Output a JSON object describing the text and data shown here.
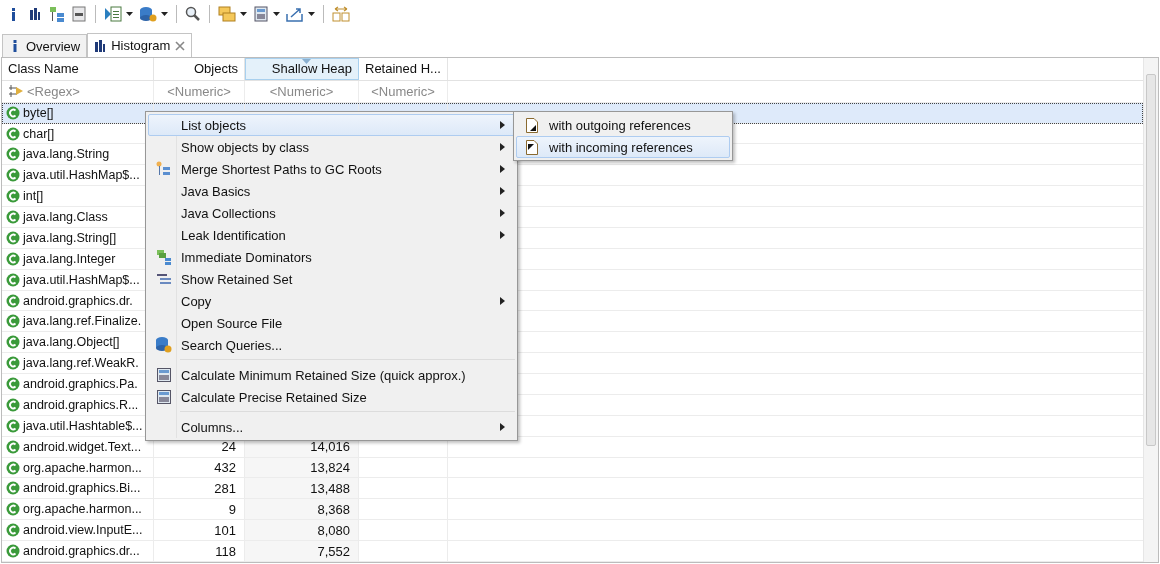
{
  "toolbar": [
    {
      "dropdown": false
    },
    {
      "dropdown": false
    },
    {
      "dropdown": false
    },
    {
      "dropdown": false
    },
    {
      "dropdown": true
    },
    {
      "dropdown": true
    },
    {
      "dropdown": false
    },
    {
      "dropdown": true
    },
    {
      "dropdown": true
    },
    {
      "dropdown": true
    },
    {
      "dropdown": false
    }
  ],
  "tabs": [
    {
      "label": "Overview",
      "selected": false,
      "closable": false
    },
    {
      "label": "Histogram",
      "selected": true,
      "closable": true
    }
  ],
  "table": {
    "columns": [
      {
        "label": "Class Name",
        "sorted": false,
        "filter": "<Regex>"
      },
      {
        "label": "Objects",
        "sorted": false,
        "filter": "<Numeric>"
      },
      {
        "label": "Shallow Heap",
        "sorted": true,
        "filter": "<Numeric>"
      },
      {
        "label": "Retained H...",
        "sorted": false,
        "filter": "<Numeric>"
      }
    ],
    "rows": [
      {
        "name": "byte[]",
        "selected": true
      },
      {
        "name": "char[]",
        "selected": false
      },
      {
        "name": "java.lang.String",
        "selected": false
      },
      {
        "name": "java.util.HashMap$...",
        "selected": false
      },
      {
        "name": "int[]",
        "selected": false
      },
      {
        "name": "java.lang.Class",
        "selected": false
      },
      {
        "name": "java.lang.String[]",
        "selected": false
      },
      {
        "name": "java.lang.Integer",
        "selected": false
      },
      {
        "name": "java.util.HashMap$...",
        "selected": false
      },
      {
        "name": "android.graphics.dr.",
        "selected": false
      },
      {
        "name": "java.lang.ref.Finalize.",
        "selected": false
      },
      {
        "name": "java.lang.Object[]",
        "selected": false
      },
      {
        "name": "java.lang.ref.WeakR.",
        "selected": false
      },
      {
        "name": "android.graphics.Pa.",
        "selected": false
      },
      {
        "name": "android.graphics.R...",
        "selected": false
      },
      {
        "name": "java.util.Hashtable$...",
        "selected": false
      },
      {
        "name": "android.widget.Text...",
        "objects": "24",
        "shallow": "14,016",
        "selected": false
      },
      {
        "name": "org.apache.harmon...",
        "objects": "432",
        "shallow": "13,824",
        "selected": false
      },
      {
        "name": "android.graphics.Bi...",
        "objects": "281",
        "shallow": "13,488",
        "selected": false
      },
      {
        "name": "org.apache.harmon...",
        "objects": "9",
        "shallow": "8,368",
        "selected": false
      },
      {
        "name": "android.view.InputE...",
        "objects": "101",
        "shallow": "8,080",
        "selected": false
      },
      {
        "name": "android.graphics.dr...",
        "objects": "118",
        "shallow": "7,552",
        "selected": false
      }
    ]
  },
  "context_menu": {
    "items": [
      {
        "kind": "item",
        "label": "List objects",
        "submenu": true,
        "selected": true
      },
      {
        "kind": "item",
        "label": "Show objects by class",
        "submenu": true,
        "selected": false
      },
      {
        "kind": "item",
        "label": "Merge Shortest Paths to GC Roots",
        "submenu": true,
        "selected": false
      },
      {
        "kind": "item",
        "label": "Java Basics",
        "submenu": true,
        "selected": false
      },
      {
        "kind": "item",
        "label": "Java Collections",
        "submenu": true,
        "selected": false
      },
      {
        "kind": "item",
        "label": "Leak Identification",
        "submenu": true,
        "selected": false
      },
      {
        "kind": "item",
        "label": "Immediate Dominators",
        "submenu": false,
        "selected": false
      },
      {
        "kind": "item",
        "label": "Show Retained Set",
        "submenu": false,
        "selected": false
      },
      {
        "kind": "item",
        "label": "Copy",
        "submenu": true,
        "selected": false
      },
      {
        "kind": "item",
        "label": "Open Source File",
        "submenu": false,
        "selected": false
      },
      {
        "kind": "item",
        "label": "Search Queries...",
        "submenu": false,
        "selected": false
      },
      {
        "kind": "separator"
      },
      {
        "kind": "item",
        "label": "Calculate Minimum Retained Size (quick approx.)",
        "submenu": false,
        "selected": false
      },
      {
        "kind": "item",
        "label": "Calculate Precise Retained Size",
        "submenu": false,
        "selected": false
      },
      {
        "kind": "separator"
      },
      {
        "kind": "item",
        "label": "Columns...",
        "submenu": true,
        "selected": false
      }
    ],
    "submenu": [
      {
        "label": "with outgoing references",
        "selected": false
      },
      {
        "label": "with incoming references",
        "selected": true
      }
    ]
  }
}
